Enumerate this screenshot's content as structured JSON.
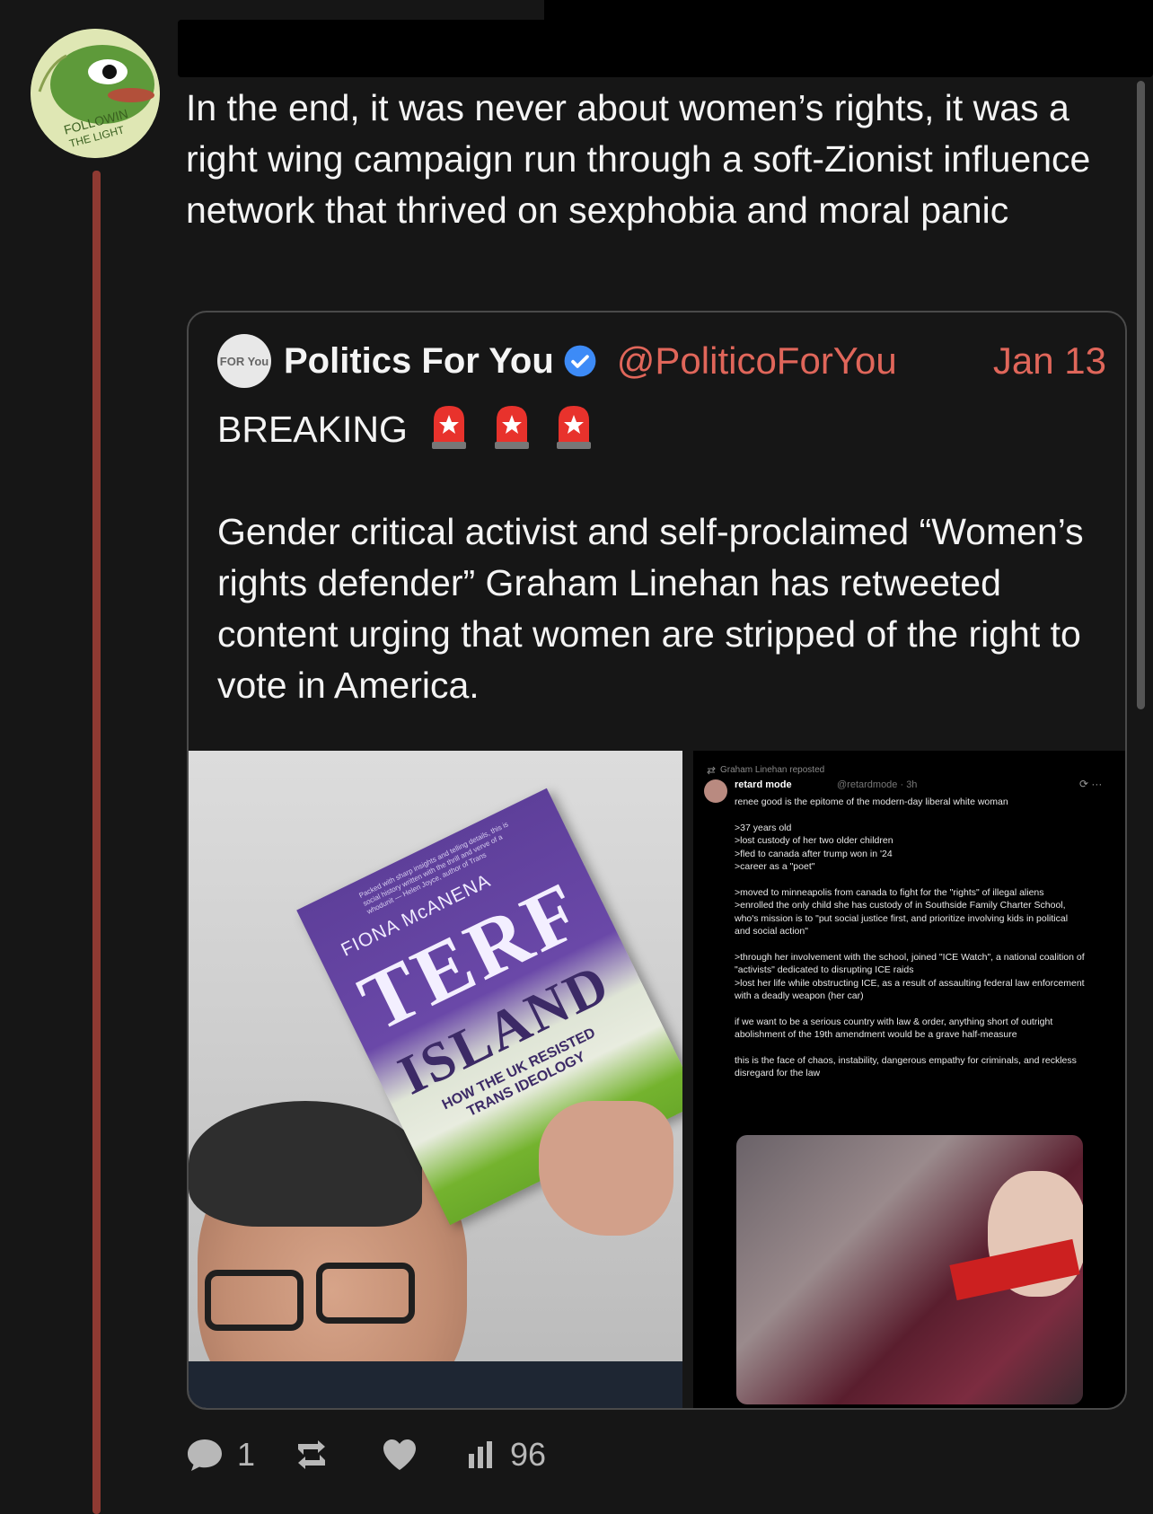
{
  "post": {
    "text": "In the end, it was never about women’s rights, it was a right wing campaign run through a soft-Zionist influence network that thrived on sexphobia and moral panic",
    "avatar_text": "FOLLOWIN THE LIGHT"
  },
  "quote": {
    "avatar_text": "FOR You",
    "name": "Politics For You",
    "handle": "@PoliticoForYou",
    "date": "Jan 13",
    "headline": "BREAKING",
    "body": "Gender critical activist and self-proclaimed “Women’s rights defender” Graham Linehan has retweeted content urging that women are stripped of the right to vote in America."
  },
  "book": {
    "author": "FIONA McANENA",
    "title1": "TERF",
    "title2": "ISLAND",
    "subtitle": "HOW THE UK RESISTED TRANS IDEOLOGY",
    "blurb": "Packed with sharp insights and telling details, this is social history written with the thrill and verve of a whodunit — Helen Joyce, author of Trans"
  },
  "retweet": {
    "reposted_by": "Graham Linehan reposted",
    "username": "retard mode",
    "handle": "@retardmode · 3h",
    "lines": [
      "renee good is the epitome of the modern-day liberal white woman",
      "",
      ">37 years old",
      ">lost custody of her two older children",
      ">fled to canada after trump won in '24",
      ">career as a \"poet\"",
      "",
      ">moved to minneapolis from canada to fight for the \"rights\" of illegal aliens",
      ">enrolled the only child she has custody of in Southside Family Charter School, who's mission is to \"put social justice first, and prioritize involving kids in political and social action\"",
      "",
      ">through her involvement with the school, joined \"ICE Watch\", a national coalition of \"activists\" dedicated to disrupting ICE raids",
      ">lost her life while obstructing ICE, as a result of assaulting federal law enforcement with a deadly weapon (her car)",
      "",
      "if we want to be a serious country with law & order, anything short of outright abolishment of the 19th amendment would be a grave half-measure",
      "",
      "this is the face of chaos, instability, dangerous empathy for criminals, and reckless disregard for the law"
    ]
  },
  "actions": {
    "reply_count": "1",
    "repost_count": "",
    "like_count": "",
    "views_count": "96"
  },
  "colors": {
    "background": "#161616",
    "accent": "#e0665a",
    "thread_line": "#8e3a32",
    "verified": "#3d8bf7"
  }
}
